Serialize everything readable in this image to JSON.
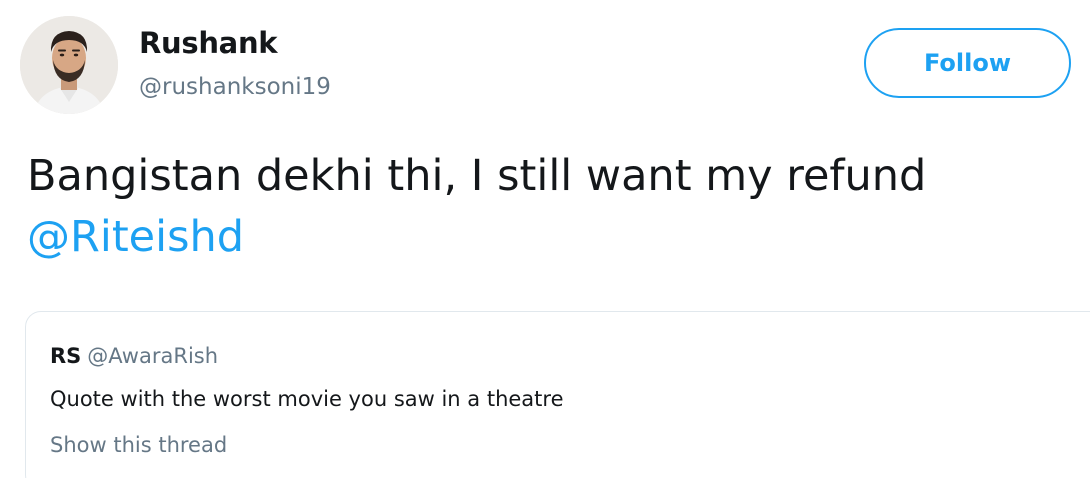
{
  "author": {
    "display_name": "Rushank",
    "handle": "@rushanksoni19"
  },
  "follow_button": {
    "label": "Follow"
  },
  "tweet": {
    "text_line1": "Bangistan dekhi thi, I still want my refund",
    "mention": "@Riteishd"
  },
  "quoted_tweet": {
    "display_name": "RS",
    "handle": "@AwaraRish",
    "text": "Quote with the worst movie you saw in a theatre",
    "show_thread": "Show this thread"
  },
  "colors": {
    "accent": "#1da1f2",
    "text_primary": "#14171a",
    "text_secondary": "#657786",
    "border": "#e1e8ed"
  }
}
